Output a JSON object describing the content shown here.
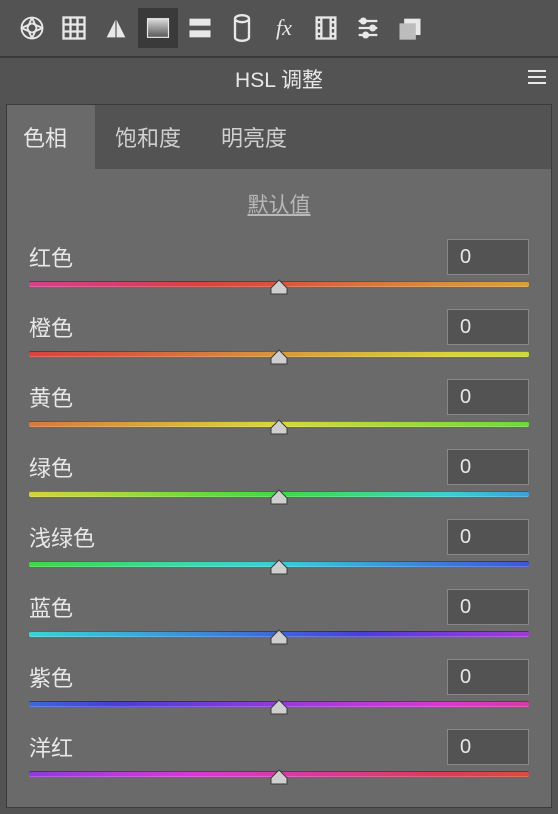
{
  "panel": {
    "title": "HSL 调整",
    "default_link": "默认值"
  },
  "tabs": {
    "hue": "色相",
    "saturation": "饱和度",
    "luminance": "明亮度"
  },
  "sliders": [
    {
      "label": "红色",
      "value": "0",
      "gradient": "linear-gradient(to right,#d6418a,#d63f6f,#d8423f,#d9553c,#d9743c,#d98e3b,#d9a03a)"
    },
    {
      "label": "橙色",
      "value": "0",
      "gradient": "linear-gradient(to right,#d9433f,#d9573c,#d9763c,#d9973b,#d9b63a,#d9d239,#ced939)"
    },
    {
      "label": "黄色",
      "value": "0",
      "gradient": "linear-gradient(to right,#d9773c,#d9983b,#d9ba3a,#d7d939,#b3d939,#8fd93a,#6cd93c)"
    },
    {
      "label": "绿色",
      "value": "0",
      "gradient": "linear-gradient(to right,#d6d339,#a9d93a,#6fd93c,#3fd945,#3ad984,#3ad2d0,#3ca0d9)"
    },
    {
      "label": "浅绿色",
      "value": "0",
      "gradient": "linear-gradient(to right,#3ed943,#3ad977,#39d9b2,#39ced9,#3aa5d9,#3c7ad9,#3f55d9)"
    },
    {
      "label": "蓝色",
      "value": "0",
      "gradient": "linear-gradient(to right,#39d4d3,#3ab3d9,#3b8ed9,#3d66d9,#4a3fd9,#7a3bd9,#a33ad9)"
    },
    {
      "label": "紫色",
      "value": "0",
      "gradient": "linear-gradient(to right,#3d69d9,#473fd9,#6c3cd9,#943bd9,#ba3ad9,#d939cf,#d93ba4)"
    },
    {
      "label": "洋红",
      "value": "0",
      "gradient": "linear-gradient(to right,#8e3bd9,#b63ad9,#d739d3,#d93aac,#d93b82,#d93d57,#d94c3e)"
    }
  ],
  "toolbar_icons": [
    "aperture-icon",
    "grid-icon",
    "triangle-icon",
    "gradient-icon",
    "split-icon",
    "cylinder-icon",
    "fx-icon",
    "film-icon",
    "sliders-icon",
    "stack-icon"
  ]
}
